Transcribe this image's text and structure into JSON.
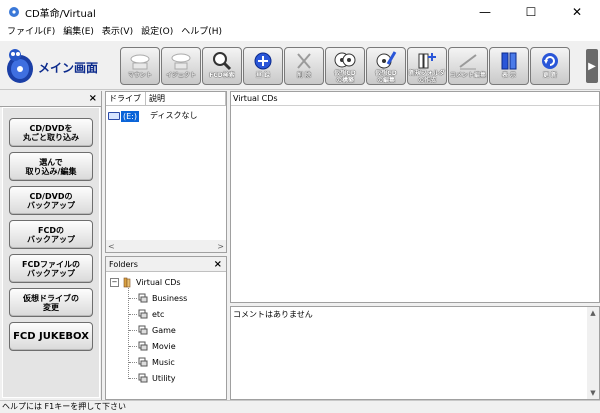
{
  "window": {
    "title": "CD革命/Virtual",
    "minimize": "—",
    "maximize": "☐",
    "close": "✕"
  },
  "menu": [
    "ファイル(F)",
    "編集(E)",
    "表示(V)",
    "設定(O)",
    "ヘルプ(H)"
  ],
  "logo": {
    "text": "メイン画面"
  },
  "toolbar": {
    "buttons": [
      {
        "label": "マウント",
        "icon": "mount-icon",
        "state": "disabled"
      },
      {
        "label": "イジェクト",
        "icon": "eject-icon",
        "state": "disabled"
      },
      {
        "label": "FCD検索",
        "icon": "magnifier-icon",
        "state": "enabled"
      },
      {
        "label": "登 録",
        "icon": "register-plus-icon",
        "state": "enabled"
      },
      {
        "label": "削 除",
        "icon": "delete-x-icon",
        "state": "disabled"
      },
      {
        "label": "仮想CD\nの構築",
        "icon": "build-cd-icon",
        "state": "enabled"
      },
      {
        "label": "仮想CD\nの編集",
        "icon": "edit-cd-icon",
        "state": "enabled"
      },
      {
        "label": "新規フォルダ\nの作成",
        "icon": "new-folder-icon",
        "state": "enabled"
      },
      {
        "label": "コメント編集",
        "icon": "comment-edit-icon",
        "state": "disabled"
      },
      {
        "label": "表 示",
        "icon": "display-icon",
        "state": "enabled"
      },
      {
        "label": "更 新",
        "icon": "refresh-icon",
        "state": "enabled"
      }
    ],
    "more": "▶"
  },
  "left_panel": {
    "close": "×",
    "buttons": [
      "CD/DVDを\n丸ごと取り込み",
      "選んで\n取り込み/編集",
      "CD/DVDの\nバックアップ",
      "FCDの\nバックアップ",
      "FCDファイルの\nバックアップ",
      "仮想ドライブの\n変更",
      "FCD JUKEBOX"
    ]
  },
  "drive_list": {
    "columns": [
      "ドライブ",
      "説明"
    ],
    "rows": [
      {
        "drive": "(E:)",
        "description": "ディスクなし"
      }
    ],
    "scroll_left": "<",
    "scroll_right": ">"
  },
  "folders": {
    "title": "Folders",
    "close": "×",
    "root": {
      "expander": "−",
      "label": "Virtual CDs"
    },
    "children": [
      "Business",
      "etc",
      "Game",
      "Movie",
      "Music",
      "Utility"
    ]
  },
  "virtual_cds": {
    "title": "Virtual CDs"
  },
  "comment": {
    "text": "コメントはありません",
    "scroll_up": "▲",
    "scroll_down": "▼"
  },
  "status_bar": {
    "text": "ヘルプには F1キーを押して下さい"
  },
  "colors": {
    "selection": "#0a64d8",
    "logo_blue": "#0b2a8c",
    "background": "#f0f0f0"
  }
}
